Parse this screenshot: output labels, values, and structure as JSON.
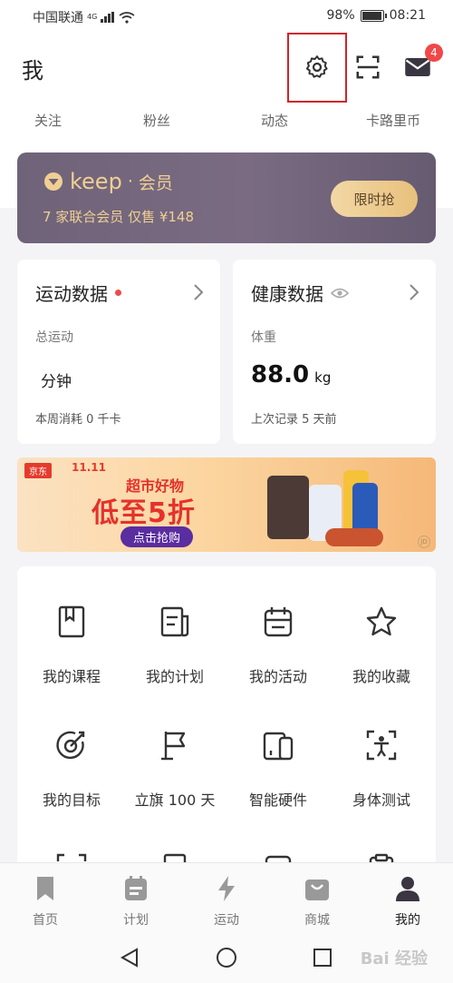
{
  "status_bar": {
    "carrier": "中国联通",
    "net": "4G",
    "battery": "98%",
    "battery_level": 0.98,
    "time": "08:21"
  },
  "header": {
    "title": "我",
    "mail_badge": "4"
  },
  "stats": {
    "follow": "关注",
    "fans": "粉丝",
    "feed": "动态",
    "calories": "卡路里币"
  },
  "membership": {
    "brand": "keep",
    "member_word": "会员",
    "desc": "7 家联合会员 仅售 ¥148",
    "cta": "限时抢"
  },
  "sport_card": {
    "title": "运动数据",
    "total_label": "总运动",
    "unit": "分钟",
    "weekly": "本周消耗 0 千卡"
  },
  "health_card": {
    "title": "健康数据",
    "weight_label": "体重",
    "weight_value": "88.0",
    "weight_unit": "kg",
    "last_record": "上次记录 5 天前"
  },
  "banner": {
    "store": "京东",
    "event": "11.11",
    "line1": "超市好物",
    "line2": "低至5折",
    "button": "点击抢购",
    "mark": "JD"
  },
  "grid": {
    "row1": [
      "我的课程",
      "我的计划",
      "我的活动",
      "我的收藏"
    ],
    "row2": [
      "我的目标",
      "立旗 100 天",
      "智能硬件",
      "身体测试"
    ]
  },
  "tabs": [
    "首页",
    "计划",
    "运动",
    "商城",
    "我的"
  ],
  "watermark": "Bai 经验",
  "colors": {
    "accent_gold": "#f0cf93",
    "badge_red": "#f04848",
    "highlight_box": "#d0232a"
  }
}
